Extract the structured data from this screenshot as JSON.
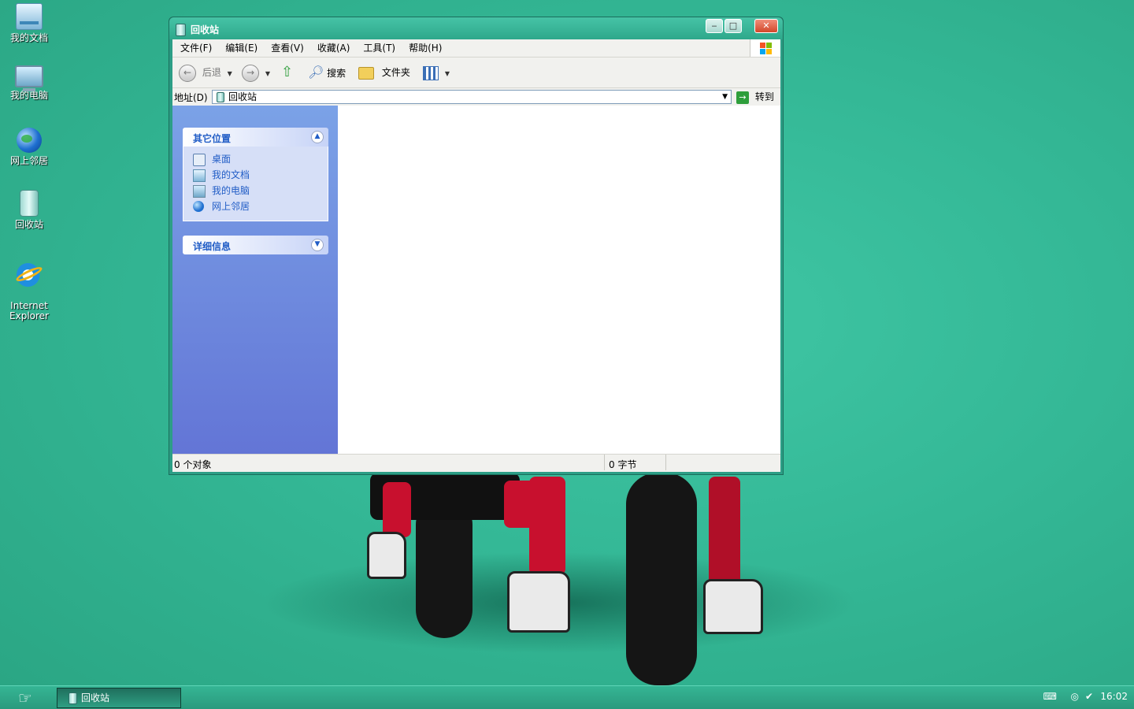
{
  "desktop": {
    "icons": [
      {
        "label": "我的文档",
        "icon": "my-documents-icon"
      },
      {
        "label": "我的电脑",
        "icon": "my-computer-icon"
      },
      {
        "label": "网上邻居",
        "icon": "network-places-icon"
      },
      {
        "label": "回收站",
        "icon": "recycle-bin-icon"
      },
      {
        "label": "Internet\nExplorer",
        "icon": "internet-explorer-icon"
      }
    ]
  },
  "window": {
    "title": "回收站",
    "controls": {
      "minimize": "‒",
      "maximize": "□",
      "close": "✕"
    },
    "menu": [
      "文件(F)",
      "编辑(E)",
      "查看(V)",
      "收藏(A)",
      "工具(T)",
      "帮助(H)"
    ],
    "toolbar": {
      "back": "后退",
      "search": "搜索",
      "folders": "文件夹"
    },
    "address": {
      "label": "地址(D)",
      "value": "回收站",
      "go": "转到"
    },
    "panels": {
      "other_places": {
        "title": "其它位置",
        "items": [
          "桌面",
          "我的文档",
          "我的电脑",
          "网上邻居"
        ]
      },
      "details": {
        "title": "详细信息"
      }
    },
    "status": {
      "objects": "0 个对象",
      "size": "0 字节"
    }
  },
  "taskbar": {
    "task_label": "回收站",
    "clock": "16:02"
  },
  "colors": {
    "accent": "#34b896",
    "panel_link": "#215dc6"
  }
}
